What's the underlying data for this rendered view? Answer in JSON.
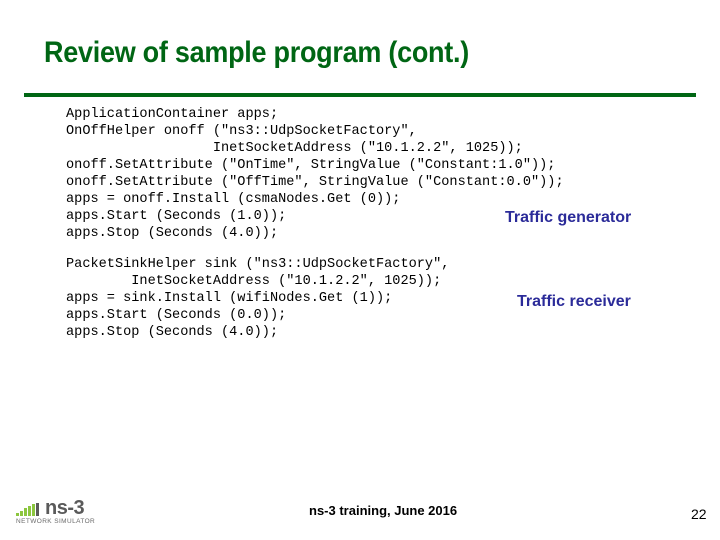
{
  "slide": {
    "title": "Review of sample program (cont.)",
    "colors": {
      "title": "#006614",
      "rule": "#006614",
      "annotation": "#2b2b99",
      "logo_bars": "#8cc63f",
      "logo_text": "#5a5a5a"
    }
  },
  "code": {
    "generator_lines": [
      "ApplicationContainer apps;",
      "OnOffHelper onoff (\"ns3::UdpSocketFactory\",",
      "                  InetSocketAddress (\"10.1.2.2\", 1025));",
      "onoff.SetAttribute (\"OnTime\", StringValue (\"Constant:1.0\"));",
      "onoff.SetAttribute (\"OffTime\", StringValue (\"Constant:0.0\"));",
      "apps = onoff.Install (csmaNodes.Get (0));",
      "apps.Start (Seconds (1.0));",
      "apps.Stop (Seconds (4.0));"
    ],
    "receiver_lines": [
      "PacketSinkHelper sink (\"ns3::UdpSocketFactory\",",
      "        InetSocketAddress (\"10.1.2.2\", 1025));",
      "apps = sink.Install (wifiNodes.Get (1));",
      "apps.Start (Seconds (0.0));",
      "apps.Stop (Seconds (4.0));"
    ]
  },
  "annotations": {
    "generator": "Traffic generator",
    "receiver": "Traffic receiver"
  },
  "footer": {
    "logo_word": "ns-3",
    "logo_subtitle": "NETWORK SIMULATOR",
    "logo_icon": "signal-bars-icon",
    "center_text": "ns-3 training, June 2016",
    "page_number": "22"
  }
}
